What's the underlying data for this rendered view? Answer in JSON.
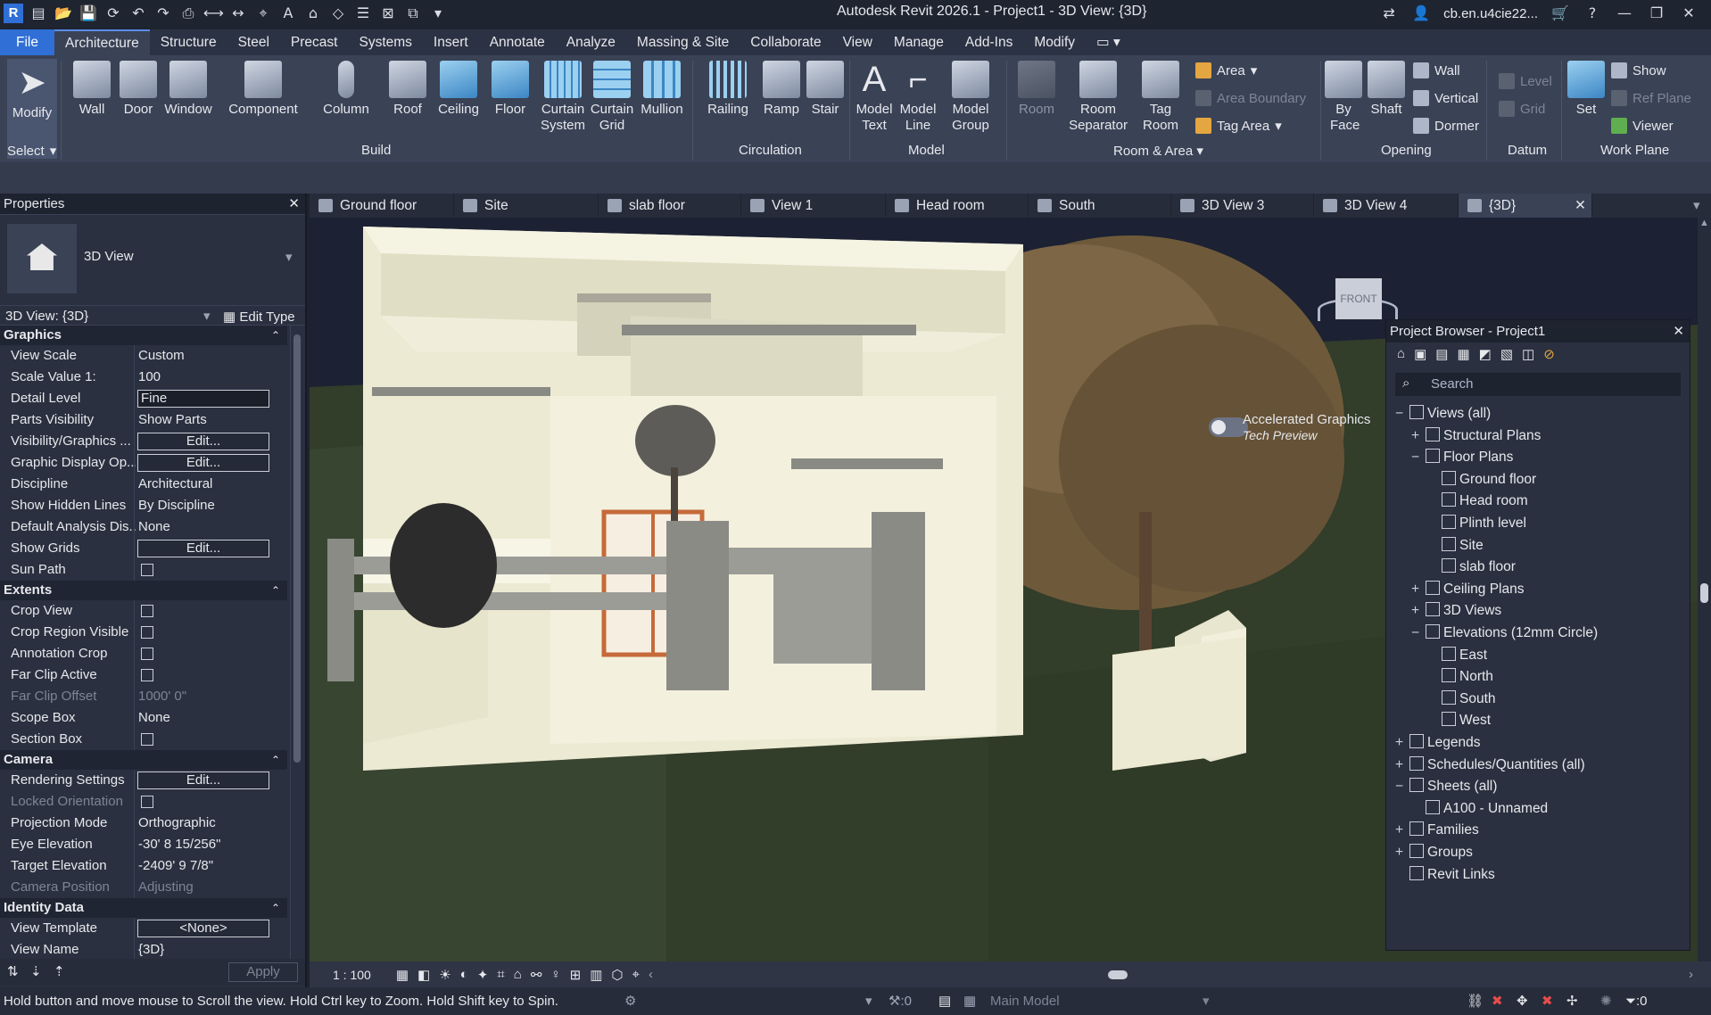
{
  "window": {
    "title": "Autodesk Revit 2026.1 - Project1 - 3D View: {3D}",
    "user": "cb.en.u4cie22..."
  },
  "menu_tabs": [
    "File",
    "Architecture",
    "Structure",
    "Steel",
    "Precast",
    "Systems",
    "Insert",
    "Annotate",
    "Analyze",
    "Massing & Site",
    "Collaborate",
    "View",
    "Manage",
    "Add-Ins",
    "Modify"
  ],
  "ribbon": {
    "modify": "Modify",
    "select": "Select",
    "build": {
      "label": "Build",
      "items": [
        "Wall",
        "Door",
        "Window",
        "Component",
        "Column",
        "Roof",
        "Ceiling",
        "Floor",
        "Curtain System",
        "Curtain Grid",
        "Mullion"
      ]
    },
    "circulation": {
      "label": "Circulation",
      "items": [
        "Railing",
        "Ramp",
        "Stair"
      ]
    },
    "model": {
      "label": "Model",
      "items": [
        "Model Text",
        "Model Line",
        "Model Group"
      ]
    },
    "room_area": {
      "label": "Room & Area",
      "items": [
        "Room",
        "Room Separator",
        "Tag Room"
      ],
      "small": [
        "Area",
        "Area Boundary",
        "Tag Area"
      ]
    },
    "opening": {
      "label": "Opening",
      "items": [
        "By Face",
        "Shaft"
      ],
      "small": [
        "Wall",
        "Vertical",
        "Dormer"
      ]
    },
    "datum": {
      "label": "Datum",
      "small": [
        "Level",
        "Grid"
      ]
    },
    "work_plane": {
      "label": "Work Plane",
      "items": [
        "Set"
      ],
      "small": [
        "Show",
        "Ref Plane",
        "Viewer"
      ]
    }
  },
  "properties": {
    "title": "Properties",
    "type_name": "3D View",
    "instance": "3D View: {3D}",
    "edit_type": "Edit Type",
    "groups": [
      {
        "name": "Graphics",
        "rows": [
          {
            "k": "View Scale",
            "v": "Custom"
          },
          {
            "k": "Scale Value    1:",
            "v": "100"
          },
          {
            "k": "Detail Level",
            "v": "Fine"
          },
          {
            "k": "Parts Visibility",
            "v": "Show Parts"
          },
          {
            "k": "Visibility/Graphics ...",
            "v": "Edit..."
          },
          {
            "k": "Graphic Display Op...",
            "v": "Edit..."
          },
          {
            "k": "Discipline",
            "v": "Architectural"
          },
          {
            "k": "Show Hidden Lines",
            "v": "By Discipline"
          },
          {
            "k": "Default Analysis Dis...",
            "v": "None"
          },
          {
            "k": "Show Grids",
            "v": "Edit..."
          },
          {
            "k": "Sun Path",
            "v": ""
          }
        ]
      },
      {
        "name": "Extents",
        "rows": [
          {
            "k": "Crop View",
            "v": ""
          },
          {
            "k": "Crop Region Visible",
            "v": ""
          },
          {
            "k": "Annotation Crop",
            "v": ""
          },
          {
            "k": "Far Clip Active",
            "v": ""
          },
          {
            "k": "Far Clip Offset",
            "v": "1000'  0\""
          },
          {
            "k": "Scope Box",
            "v": "None"
          },
          {
            "k": "Section Box",
            "v": ""
          }
        ]
      },
      {
        "name": "Camera",
        "rows": [
          {
            "k": "Rendering Settings",
            "v": "Edit..."
          },
          {
            "k": "Locked Orientation",
            "v": ""
          },
          {
            "k": "Projection Mode",
            "v": "Orthographic"
          },
          {
            "k": "Eye Elevation",
            "v": "-30'  8 15/256\""
          },
          {
            "k": "Target Elevation",
            "v": "-2409'  9 7/8\""
          },
          {
            "k": "Camera Position",
            "v": "Adjusting"
          }
        ]
      },
      {
        "name": "Identity Data",
        "rows": [
          {
            "k": "View Template",
            "v": "<None>"
          },
          {
            "k": "View Name",
            "v": "{3D}"
          }
        ]
      }
    ],
    "apply": "Apply"
  },
  "view_tabs": [
    "Ground floor",
    "Site",
    "slab floor",
    "View 1",
    "Head room",
    "South",
    "3D View 3",
    "3D View 4",
    "{3D}"
  ],
  "viewport": {
    "accelerated_graphics": "Accelerated Graphics",
    "tech_preview": "Tech Preview",
    "viewcube_face": "FRONT"
  },
  "project_browser": {
    "title": "Project Browser - Project1",
    "search_placeholder": "Search",
    "tree": [
      {
        "label": "Views (all)",
        "level": 0,
        "exp": "−"
      },
      {
        "label": "Structural Plans",
        "level": 1,
        "exp": "+"
      },
      {
        "label": "Floor Plans",
        "level": 1,
        "exp": "−"
      },
      {
        "label": "Ground floor",
        "level": 2
      },
      {
        "label": "Head room",
        "level": 2
      },
      {
        "label": "Plinth level",
        "level": 2
      },
      {
        "label": "Site",
        "level": 2
      },
      {
        "label": "slab floor",
        "level": 2
      },
      {
        "label": "Ceiling Plans",
        "level": 1,
        "exp": "+"
      },
      {
        "label": "3D Views",
        "level": 1,
        "exp": "+"
      },
      {
        "label": "Elevations (12mm Circle)",
        "level": 1,
        "exp": "−"
      },
      {
        "label": "East",
        "level": 2
      },
      {
        "label": "North",
        "level": 2
      },
      {
        "label": "South",
        "level": 2
      },
      {
        "label": "West",
        "level": 2
      },
      {
        "label": "Legends",
        "level": 0,
        "exp": "+"
      },
      {
        "label": "Schedules/Quantities (all)",
        "level": 0,
        "exp": "+"
      },
      {
        "label": "Sheets (all)",
        "level": 0,
        "exp": "−"
      },
      {
        "label": "A100 - Unnamed",
        "level": 1
      },
      {
        "label": "Families",
        "level": 0,
        "exp": "+"
      },
      {
        "label": "Groups",
        "level": 0,
        "exp": "+"
      },
      {
        "label": "Revit Links",
        "level": 0
      }
    ]
  },
  "view_control_bar": {
    "scale": "1 : 100"
  },
  "status": {
    "hint": "Hold button and move mouse to Scroll the view. Hold Ctrl key to Zoom. Hold Shift key to Spin.",
    "workset_count": ":0",
    "model": "Main Model",
    "filter_count": ":0"
  }
}
